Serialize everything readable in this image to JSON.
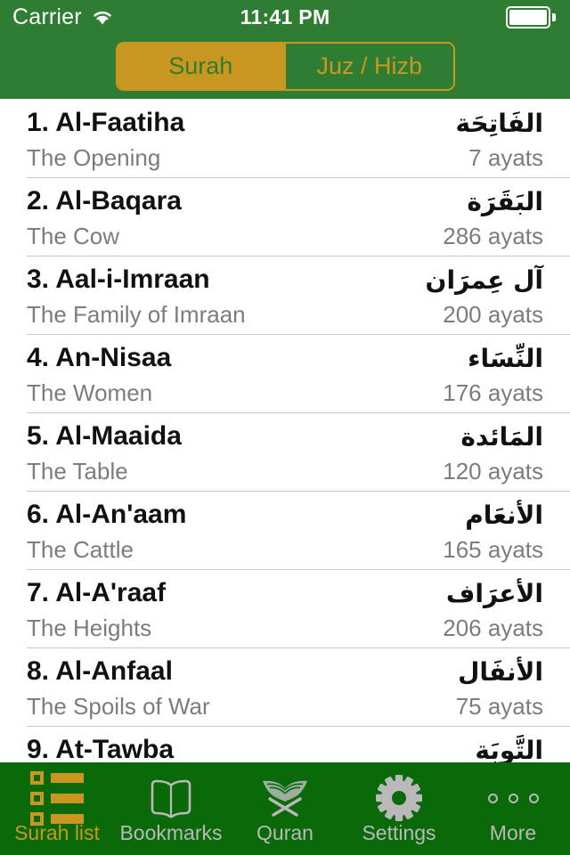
{
  "statusbar": {
    "carrier": "Carrier",
    "wifi_icon": "wifi-icon",
    "time": "11:41 PM",
    "battery_icon": "battery-full-icon"
  },
  "navbar": {
    "segments": [
      {
        "label": "Surah",
        "active": true
      },
      {
        "label": "Juz / Hizb",
        "active": false
      }
    ]
  },
  "colors": {
    "header_green": "#2E7D32",
    "tabbar_green": "#0A6A0A",
    "accent_gold": "#C9971F",
    "separator": "#c8c7cc",
    "secondary_text": "#7c7c7c",
    "inactive_tab_text": "#b9b9b9"
  },
  "list": {
    "rows": [
      {
        "name": "1. Al-Faatiha",
        "arabic": "الفَاتِحَة",
        "meaning": "The Opening",
        "ayats": "7 ayats"
      },
      {
        "name": "2. Al-Baqara",
        "arabic": "البَقَرَة",
        "meaning": "The Cow",
        "ayats": "286 ayats"
      },
      {
        "name": "3. Aal-i-Imraan",
        "arabic": "آل عِمرَان",
        "meaning": "The Family of Imraan",
        "ayats": "200 ayats"
      },
      {
        "name": "4. An-Nisaa",
        "arabic": "النِّسَاء",
        "meaning": "The Women",
        "ayats": "176 ayats"
      },
      {
        "name": "5. Al-Maaida",
        "arabic": "المَائدة",
        "meaning": "The Table",
        "ayats": "120 ayats"
      },
      {
        "name": "6. Al-An'aam",
        "arabic": "الأنعَام",
        "meaning": "The Cattle",
        "ayats": "165 ayats"
      },
      {
        "name": "7. Al-A'raaf",
        "arabic": "الأعرَاف",
        "meaning": "The Heights",
        "ayats": "206 ayats"
      },
      {
        "name": "8. Al-Anfaal",
        "arabic": "الأنفَال",
        "meaning": "The Spoils of War",
        "ayats": "75 ayats"
      },
      {
        "name": "9. At-Tawba",
        "arabic": "التَّوبَة",
        "meaning": "",
        "ayats": ""
      }
    ]
  },
  "tabbar": {
    "tabs": [
      {
        "label": "Surah list",
        "icon": "list-icon",
        "active": true
      },
      {
        "label": "Bookmarks",
        "icon": "open-book-icon",
        "active": false
      },
      {
        "label": "Quran",
        "icon": "quran-icon",
        "active": false
      },
      {
        "label": "Settings",
        "icon": "gear-icon",
        "active": false
      },
      {
        "label": "More",
        "icon": "more-dots-icon",
        "active": false
      }
    ]
  }
}
